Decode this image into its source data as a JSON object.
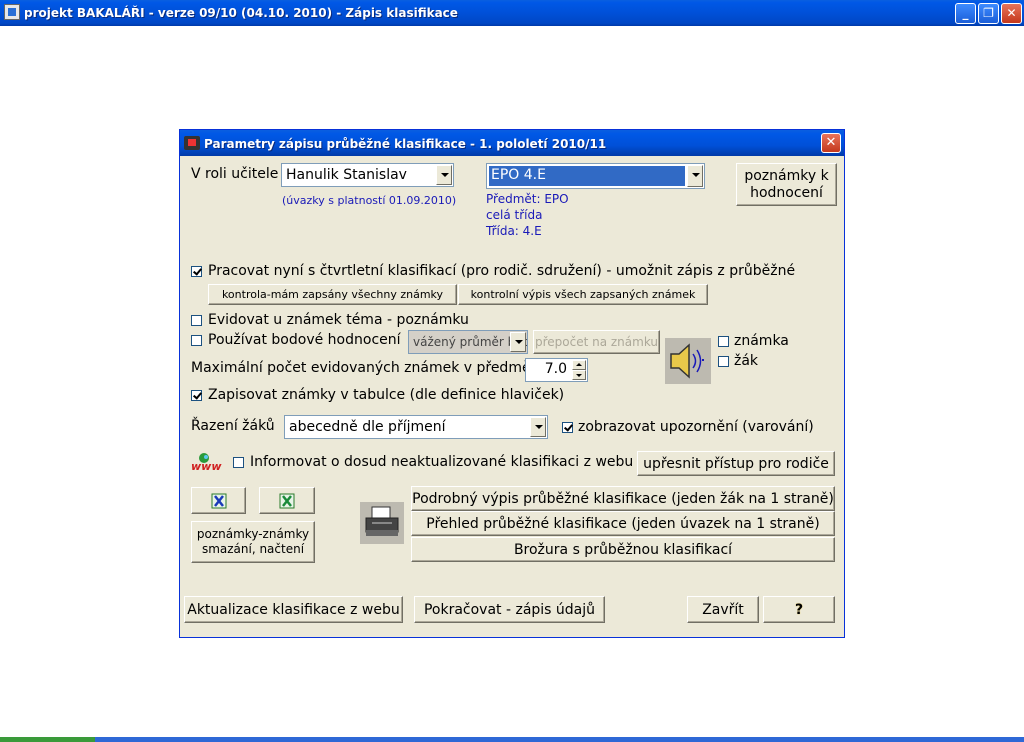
{
  "window": {
    "title": "projekt BAKALÁŘI  - verze 09/10 (04.10. 2010)  -  Zápis klasifikace",
    "minimize": "_",
    "restore": "❐",
    "close": "✕"
  },
  "dialog": {
    "title": "Parametry zápisu průběžné klasifikace - 1. pololetí 2010/11",
    "close": "✕",
    "teacher_label": "V roli učitele",
    "teacher_value": "Hanulik Stanislav",
    "assignments_validity": "(úvazky s platností 01.09.2010)",
    "class_value": "EPO 4.E",
    "subject_info": "Předmět: EPO",
    "group_info": "celá třída",
    "class_info": "Třída: 4.E",
    "notes_button": [
      "poznámky k",
      "hodnocení"
    ],
    "quarterly_check": {
      "checked": true,
      "label": "Pracovat nyní s čtvrtletní klasifikací (pro rodič. sdružení) - umožnit zápis z průběžné"
    },
    "check_all_button": "kontrola-mám zapsány všechny známky",
    "control_listing_button": "kontrolní výpis všech zapsaných známek",
    "topic_check": {
      "checked": false,
      "label": "Evidovat u známek téma - poznámku"
    },
    "points_check": {
      "checked": false,
      "label": "Používat bodové hodnocení"
    },
    "points_method": "vážený průměr bodů",
    "recalc_button": "přepočet na známku",
    "grade_check": {
      "checked": false,
      "label": "známka"
    },
    "student_check": {
      "checked": false,
      "label": "žák"
    },
    "max_grades_label": "Maximální počet evidovaných známek v předmětu",
    "max_grades_value": "7.0",
    "table_check": {
      "checked": true,
      "label": "Zapisovat známky v tabulce (dle definice hlaviček)"
    },
    "sort_label": "Řazení žáků",
    "sort_value": "abecedně dle příjmení",
    "warnings_check": {
      "checked": true,
      "label": "zobrazovat upozornění (varování)"
    },
    "web_icon_text": "www",
    "web_inform_check": {
      "checked": false,
      "label": "Informovat o dosud neaktualizované klasifikaci z webu"
    },
    "parent_access_button": "upřesnit přístup pro rodiče",
    "notes_grades_button": [
      "poznámky-známky",
      "smazání, načtení"
    ],
    "print_detailed_button": "Podrobný výpis průběžné klasifikace (jeden žák na 1 straně)",
    "print_overview_button": "Přehled průběžné klasifikace (jeden úvazek na 1 straně)",
    "print_booklet_button": "Brožura s průběžnou klasifikací",
    "web_update_button": "Aktualizace klasifikace z webu",
    "continue_button": "Pokračovat - zápis údajů",
    "close_button": "Zavřít",
    "help_button": "?"
  }
}
